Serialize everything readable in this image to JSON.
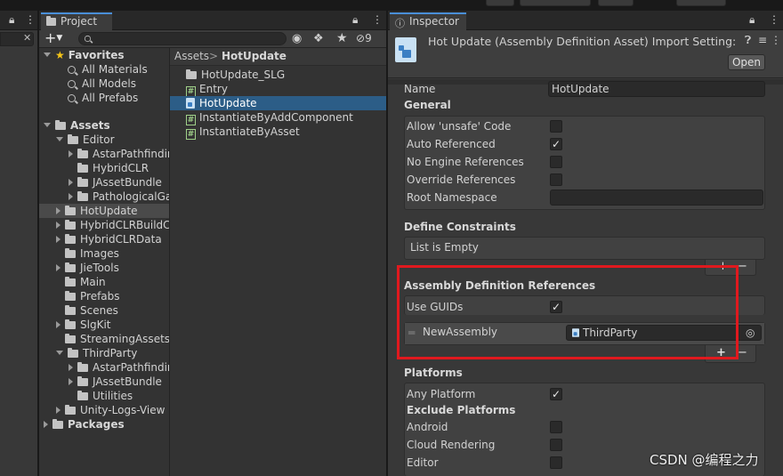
{
  "tabs": {
    "project": "Project",
    "inspector": "Inspector"
  },
  "project": {
    "search_count": "9",
    "search_value": "",
    "breadcrumb": {
      "root": "Assets",
      "sep": ">",
      "current": "HotUpdate"
    },
    "favorites": {
      "label": "Favorites",
      "items": [
        "All Materials",
        "All Models",
        "All Prefabs"
      ]
    },
    "assets_label": "Assets",
    "editor_label": "Editor",
    "editor_children": [
      "AstarPathfindir",
      "HybridCLR",
      "JAssetBundle",
      "PathologicalGa"
    ],
    "asset_folders": [
      "HotUpdate",
      "HybridCLRBuildC",
      "HybridCLRData",
      "Images",
      "JieTools",
      "Main",
      "Prefabs",
      "Scenes",
      "SlgKit",
      "StreamingAssets"
    ],
    "thirdparty_label": "ThirdParty",
    "thirdparty_children": [
      "AstarPathfindir",
      "JAssetBundle",
      "Utilities"
    ],
    "unity_logs": "Unity-Logs-View",
    "packages_label": "Packages",
    "files": [
      {
        "name": "HotUpdate_SLG",
        "kind": "folder"
      },
      {
        "name": "Entry",
        "kind": "script"
      },
      {
        "name": "HotUpdate",
        "kind": "asmdef"
      },
      {
        "name": "InstantiateByAddComponent",
        "kind": "script"
      },
      {
        "name": "InstantiateByAsset",
        "kind": "script"
      }
    ]
  },
  "inspector": {
    "title": "Hot Update (Assembly Definition Asset) Import Setting:",
    "open_button": "Open",
    "name_label": "Name",
    "name_value": "HotUpdate",
    "general": {
      "header": "General",
      "allow_unsafe": {
        "label": "Allow 'unsafe' Code",
        "checked": false
      },
      "auto_referenced": {
        "label": "Auto Referenced",
        "checked": true
      },
      "no_engine_refs": {
        "label": "No Engine References",
        "checked": false
      },
      "override_refs": {
        "label": "Override References",
        "checked": false
      },
      "root_namespace": {
        "label": "Root Namespace",
        "value": ""
      }
    },
    "define_constraints": {
      "header": "Define Constraints",
      "empty_text": "List is Empty"
    },
    "asm_refs": {
      "header": "Assembly Definition References",
      "use_guids": {
        "label": "Use GUIDs",
        "checked": true
      },
      "entry_label": "NewAssembly",
      "entry_value": "ThirdParty"
    },
    "platforms": {
      "header": "Platforms",
      "any_platform": {
        "label": "Any Platform",
        "checked": true
      },
      "exclude_header": "Exclude Platforms",
      "items": [
        {
          "label": "Android",
          "checked": false
        },
        {
          "label": "Cloud Rendering",
          "checked": false
        },
        {
          "label": "Editor",
          "checked": false
        }
      ]
    }
  },
  "plus": "+",
  "minus": "−",
  "watermark": "CSDN @编程之力",
  "colors": {
    "accent": "#4a8fd8",
    "selection": "#2c5d87",
    "highlight_box": "#e0191e"
  }
}
